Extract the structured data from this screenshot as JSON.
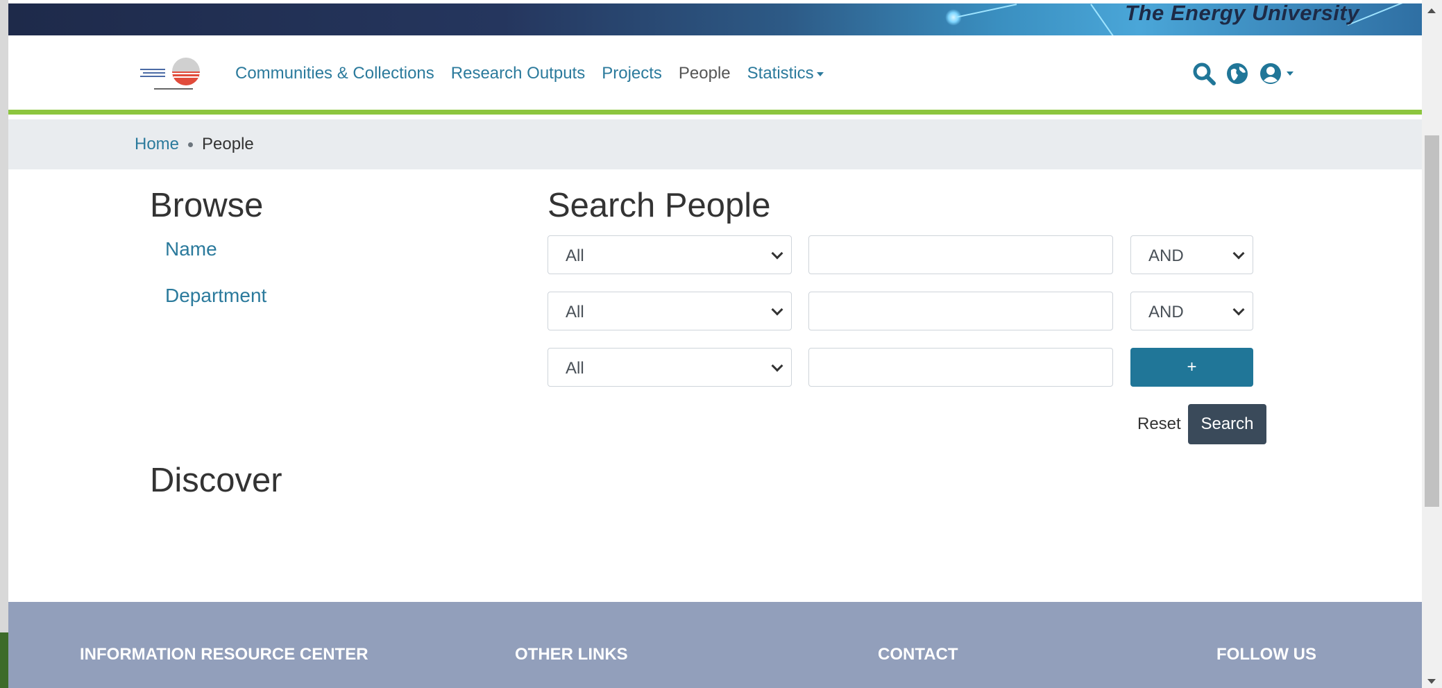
{
  "banner": {
    "title": "The Energy University"
  },
  "nav": {
    "logo_alt": "The Energy University",
    "links": [
      {
        "label": "Communities & Collections"
      },
      {
        "label": "Research Outputs"
      },
      {
        "label": "Projects"
      },
      {
        "label": "People"
      },
      {
        "label": "Statistics"
      }
    ],
    "icons": [
      "search-icon",
      "globe-icon",
      "user-circle-icon"
    ]
  },
  "breadcrumb": {
    "home": "Home",
    "current": "People"
  },
  "browse": {
    "title": "Browse",
    "links": [
      {
        "label": "Name"
      },
      {
        "label": "Department"
      }
    ]
  },
  "search": {
    "title": "Search People",
    "rows": [
      {
        "field": "All",
        "value": "",
        "operator": "AND"
      },
      {
        "field": "All",
        "value": "",
        "operator": "AND"
      },
      {
        "field": "All",
        "value": ""
      }
    ],
    "add_label": "+",
    "reset_label": "Reset",
    "search_label": "Search"
  },
  "discover": {
    "title": "Discover"
  },
  "footer": {
    "headings": [
      "INFORMATION RESOURCE CENTER",
      "OTHER LINKS",
      "CONTACT",
      "FOLLOW US"
    ]
  },
  "colors": {
    "link": "#2b7a9c",
    "accent_green": "#8dc63f",
    "primary_button": "#207698",
    "dark_button": "#3a4a5a",
    "footer": "#929fbb"
  }
}
